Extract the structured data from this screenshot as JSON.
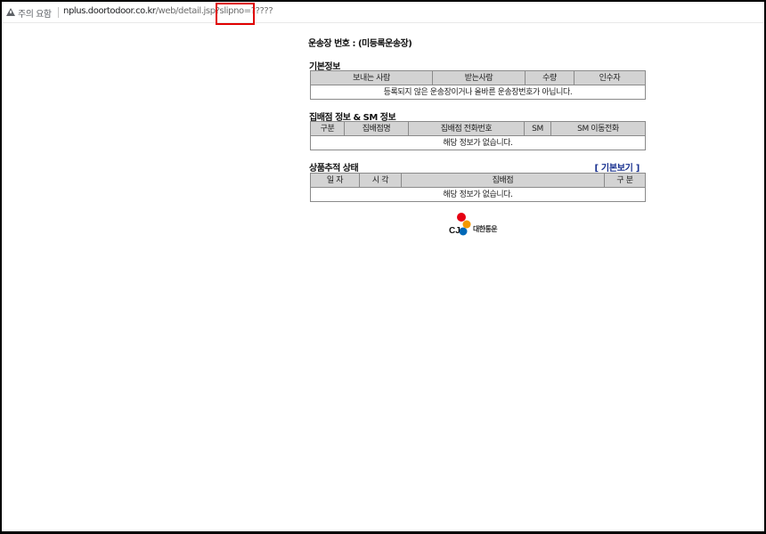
{
  "address_bar": {
    "security_label": "주의 요함",
    "url_host": "nplus.doortodoor.co.kr",
    "url_path": "/web/detail.jsp?slipno=?????"
  },
  "page": {
    "title": "운송장 번호 : (미등록운송장)",
    "basic_info": {
      "heading": "기본정보",
      "columns": [
        "보내는 사람",
        "받는사람",
        "수량",
        "인수자"
      ],
      "message": "등록되지 않은 운송장이거나 올바른 운송장번호가 아닙니다."
    },
    "branch_info": {
      "heading": "집배점 정보 & SM 정보",
      "columns": [
        "구분",
        "집배점명",
        "집배점 전화번호",
        "SM",
        "SM 이동전화"
      ],
      "message": "해당 정보가 없습니다."
    },
    "tracking": {
      "heading": "상품추적 상태",
      "link_label": "[ 기본보기 ]",
      "columns": [
        "일 자",
        "시 각",
        "집배점",
        "구 분"
      ],
      "message": "해당 정보가 없습니다."
    },
    "logo": {
      "mark": "CJ",
      "text": "대한통운",
      "colors": {
        "red": "#e60012",
        "orange": "#f39800",
        "blue": "#0068b7"
      }
    }
  }
}
